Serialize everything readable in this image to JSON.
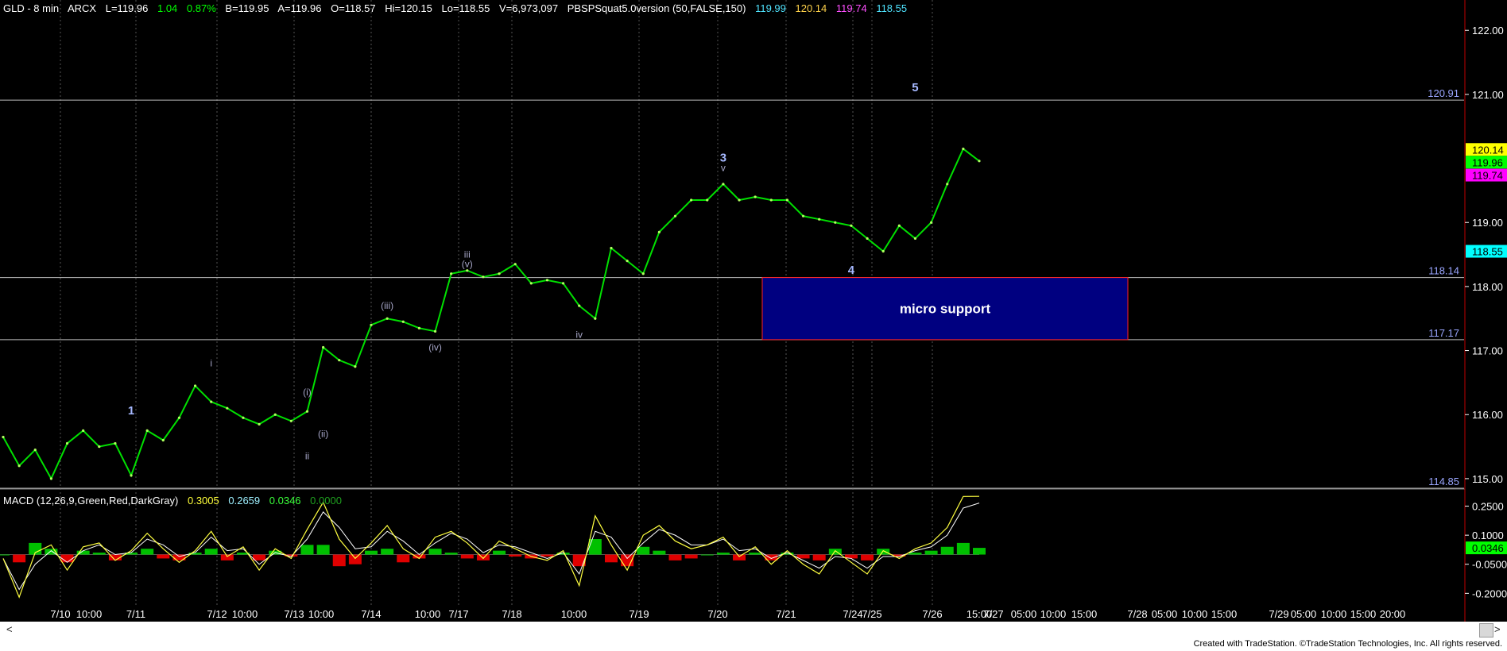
{
  "header": {
    "symbol": "GLD - 8 min",
    "exchange": "ARCX",
    "last": "L=119.96",
    "change": "1.04",
    "change_pct": "0.87%",
    "bid": "B=119.95",
    "ask": "A=119.96",
    "open": "O=118.57",
    "high": "Hi=120.15",
    "low": "Lo=118.55",
    "volume": "V=6,973,097",
    "study": "PBSPSquat5.0version (50,FALSE,150)",
    "study_values": [
      {
        "text": "119.99",
        "color": "#4fe4ff"
      },
      {
        "text": "120.14",
        "color": "#ffd24a"
      },
      {
        "text": "119.74",
        "color": "#ff4fff"
      },
      {
        "text": "118.55",
        "color": "#4fe4ff"
      }
    ]
  },
  "macd_header": {
    "label": "MACD (12,26,9,Green,Red,DarkGray)",
    "values": [
      {
        "text": "0.3005",
        "color": "#ffff3a"
      },
      {
        "text": "0.2659",
        "color": "#9ef0ff"
      },
      {
        "text": "0.0346",
        "color": "#3aff3a"
      },
      {
        "text": "0.0000",
        "color": "#1fa01f"
      }
    ]
  },
  "chart_data": {
    "type": "line",
    "title": "GLD - 8 min",
    "x_ticks": [
      "7/10",
      "10:00",
      "7/11",
      "7/12",
      "10:00",
      "7/13",
      "10:00",
      "7/14",
      "10:00",
      "7/17",
      "7/18",
      "10:00",
      "7/19",
      "7/20",
      "7/21",
      "7/24",
      "7/25",
      "7/26",
      "15:00",
      "7/27",
      "05:00",
      "10:00",
      "15:00",
      "7/28",
      "05:00",
      "10:00",
      "15:00",
      "7/29",
      "05:00",
      "10:00",
      "15:00",
      "20:00"
    ],
    "y_ticks": [
      "122.00",
      "121.00",
      "119.00",
      "118.00",
      "117.00",
      "116.00",
      "115.00"
    ],
    "ylim": [
      114.85,
      122.35
    ],
    "price_series": {
      "name": "GLD",
      "values": [
        115.65,
        115.2,
        115.45,
        115.0,
        115.55,
        115.75,
        115.5,
        115.55,
        115.05,
        115.75,
        115.6,
        115.95,
        116.45,
        116.2,
        116.1,
        115.95,
        115.85,
        116.0,
        115.9,
        116.05,
        117.05,
        116.85,
        116.75,
        117.4,
        117.5,
        117.45,
        117.35,
        117.3,
        118.2,
        118.25,
        118.15,
        118.2,
        118.35,
        118.05,
        118.1,
        118.05,
        117.7,
        117.5,
        118.6,
        118.4,
        118.2,
        118.85,
        119.1,
        119.35,
        119.35,
        119.6,
        119.35,
        119.4,
        119.35,
        119.35,
        119.1,
        119.05,
        119.0,
        118.95,
        118.75,
        118.55,
        118.95,
        118.75,
        119.0,
        119.6,
        120.15,
        119.96
      ]
    },
    "horizontal_levels": [
      {
        "value": 120.91,
        "label": "120.91"
      },
      {
        "value": 118.14,
        "label": "118.14"
      },
      {
        "value": 117.17,
        "label": "117.17"
      },
      {
        "value": 114.85,
        "label": "114.85"
      }
    ],
    "price_tags": [
      {
        "value": 120.14,
        "label": "120.14",
        "bg": "#ffff00",
        "fg": "#000000"
      },
      {
        "value": 119.96,
        "label": "119.96",
        "bg": "#00ff00",
        "fg": "#000000"
      },
      {
        "value": 119.74,
        "label": "119.74",
        "bg": "#ff00ff",
        "fg": "#000000"
      },
      {
        "value": 118.55,
        "label": "118.55",
        "bg": "#00ffff",
        "fg": "#000000"
      }
    ],
    "zone": {
      "label": "micro support",
      "top": 118.14,
      "bottom": 117.17,
      "fill": "#000080",
      "border": "#ff2020"
    },
    "wave_labels": [
      {
        "text": "1",
        "i": 8,
        "y": 116.0,
        "major": true
      },
      {
        "text": "i",
        "i": 13,
        "y": 116.75,
        "major": false
      },
      {
        "text": "(i)",
        "i": 19,
        "y": 116.3,
        "major": false
      },
      {
        "text": "(ii)",
        "i": 20,
        "y": 115.65,
        "major": false
      },
      {
        "text": "ii",
        "i": 19,
        "y": 115.3,
        "major": false
      },
      {
        "text": "(iii)",
        "i": 24,
        "y": 117.65,
        "major": false
      },
      {
        "text": "(iv)",
        "i": 27,
        "y": 117.0,
        "major": false
      },
      {
        "text": "iii",
        "i": 29,
        "y": 118.45,
        "major": false
      },
      {
        "text": "(v)",
        "i": 29,
        "y": 118.3,
        "major": false
      },
      {
        "text": "iv",
        "i": 36,
        "y": 117.2,
        "major": false
      },
      {
        "text": "3",
        "i": 45,
        "y": 119.95,
        "major": true
      },
      {
        "text": "v",
        "i": 45,
        "y": 119.8,
        "major": false
      },
      {
        "text": "4",
        "i": 53,
        "y": 118.2,
        "major": true
      },
      {
        "text": "5",
        "i": 57,
        "y": 121.05,
        "major": true
      }
    ],
    "macd": {
      "ylabels": [
        "0.2500",
        "0.1000",
        "-0.0500",
        "-0.2000"
      ],
      "ylim": [
        -0.26,
        0.33
      ],
      "current_tag": {
        "label": "0.0346",
        "bg": "#00ff00",
        "fg": "#000000"
      },
      "macd_values": [
        -0.02,
        -0.22,
        0.01,
        0.05,
        -0.08,
        0.04,
        0.06,
        -0.03,
        0.02,
        0.11,
        0.03,
        -0.04,
        0.02,
        0.12,
        -0.01,
        0.04,
        -0.08,
        0.03,
        -0.02,
        0.13,
        0.27,
        0.08,
        -0.02,
        0.06,
        0.15,
        0.03,
        -0.02,
        0.09,
        0.12,
        0.06,
        -0.02,
        0.07,
        0.03,
        -0.01,
        -0.03,
        0.02,
        -0.16,
        0.2,
        0.05,
        -0.08,
        0.1,
        0.15,
        0.07,
        0.03,
        0.05,
        0.09,
        -0.01,
        0.04,
        -0.05,
        0.02,
        -0.05,
        -0.1,
        0.02,
        -0.04,
        -0.1,
        0.02,
        -0.02,
        0.03,
        0.06,
        0.14,
        0.3,
        0.3005
      ],
      "signal_values": [
        -0.02,
        -0.18,
        -0.05,
        0.02,
        -0.04,
        0.02,
        0.05,
        0.0,
        0.01,
        0.08,
        0.05,
        -0.01,
        0.01,
        0.09,
        0.02,
        0.03,
        -0.05,
        0.01,
        -0.01,
        0.08,
        0.22,
        0.14,
        0.03,
        0.04,
        0.12,
        0.07,
        0.0,
        0.06,
        0.11,
        0.08,
        0.01,
        0.05,
        0.04,
        0.01,
        -0.02,
        0.01,
        -0.1,
        0.12,
        0.09,
        -0.02,
        0.06,
        0.13,
        0.1,
        0.05,
        0.05,
        0.08,
        0.02,
        0.03,
        -0.02,
        0.01,
        -0.03,
        -0.07,
        -0.01,
        -0.02,
        -0.07,
        -0.01,
        -0.01,
        0.02,
        0.04,
        0.1,
        0.24,
        0.2659
      ]
    }
  },
  "scrollbar": {
    "left_arrow": "<",
    "right_arrow": ">"
  },
  "footer": {
    "text": "Created with TradeStation. ©TradeStation Technologies, Inc. All rights reserved."
  }
}
